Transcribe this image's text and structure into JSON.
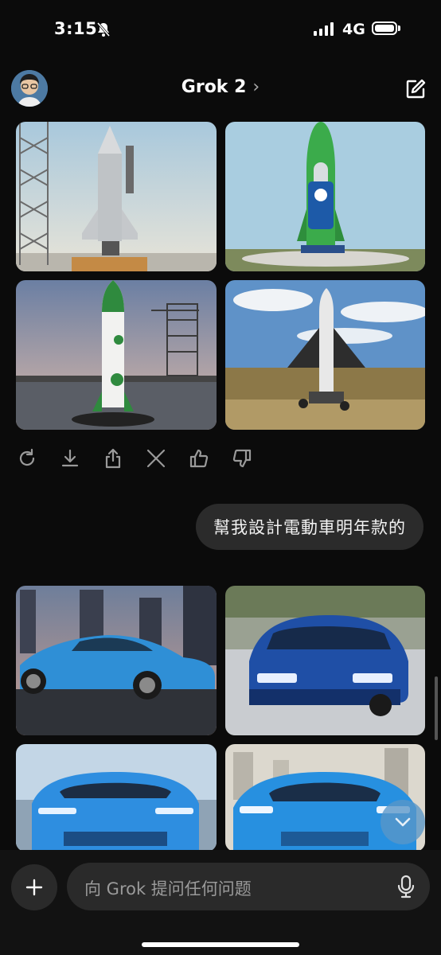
{
  "status": {
    "time": "3:15",
    "network": "4G"
  },
  "header": {
    "title": "Grok 2",
    "chevron": "›"
  },
  "icons": {
    "regenerate": "refresh-icon",
    "download": "download-icon",
    "share": "share-icon",
    "x": "x-logo-icon",
    "like": "thumbs-up-icon",
    "dislike": "thumbs-down-icon"
  },
  "messages": {
    "user_prompt": "幫我設計電動車明年款的"
  },
  "composer": {
    "placeholder": "向 Grok 提问任何问题"
  },
  "colors": {
    "background": "#0b0b0b",
    "bubble": "#2b2b2b",
    "accent": "#5a96c8"
  }
}
